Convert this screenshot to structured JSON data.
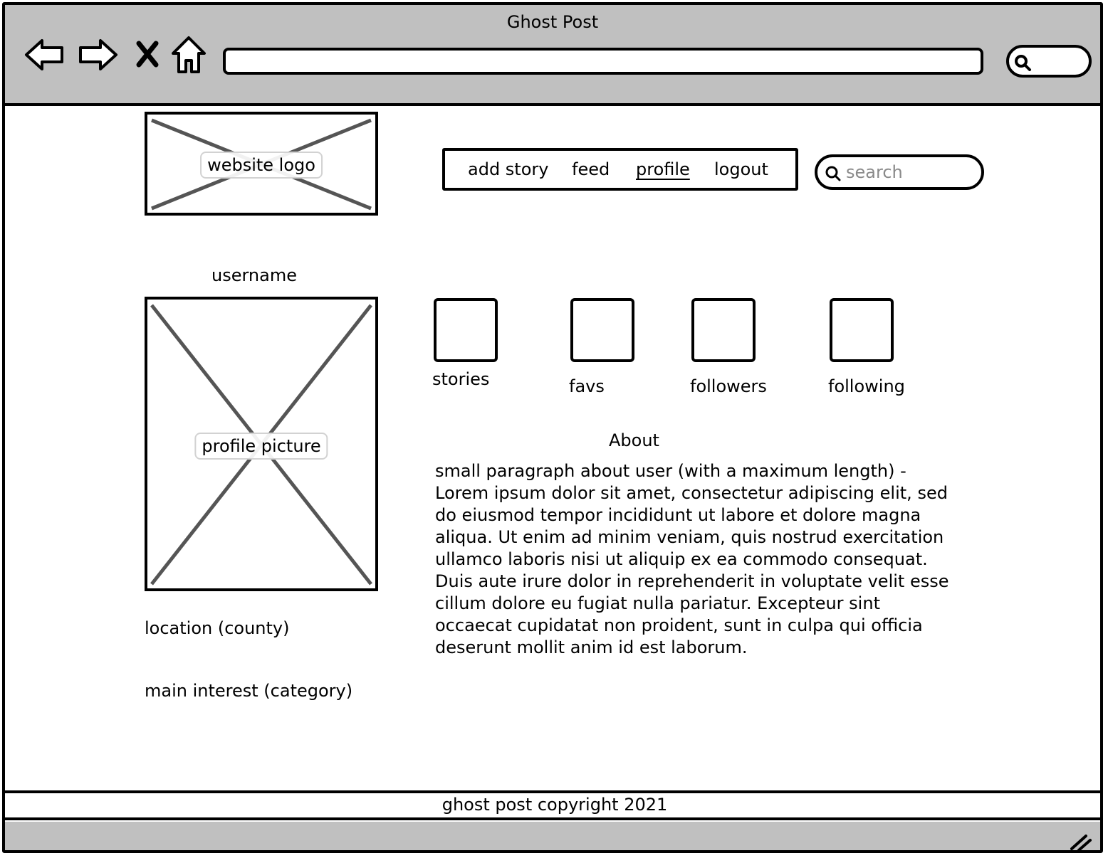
{
  "window": {
    "title": "Ghost Post"
  },
  "header": {
    "logo_label": "website logo",
    "nav": [
      {
        "label": "add story",
        "active": false
      },
      {
        "label": "feed",
        "active": false
      },
      {
        "label": "profile",
        "active": true
      },
      {
        "label": "logout",
        "active": false
      }
    ],
    "search_placeholder": "search"
  },
  "profile": {
    "username": "username",
    "picture_label": "profile picture",
    "location": "location (county)",
    "main_interest": "main interest (category)",
    "stats": [
      {
        "label": "stories"
      },
      {
        "label": "favs"
      },
      {
        "label": "followers"
      },
      {
        "label": "following"
      }
    ],
    "about_title": "About",
    "about_text": "small paragraph about user (with a maximum length) -Lorem ipsum dolor sit amet, consectetur adipiscing elit, sed do eiusmod tempor incididunt ut labore et dolore magna aliqua. Ut enim ad minim veniam, quis nostrud exercitation ullamco laboris nisi ut aliquip ex ea commodo consequat. Duis aute irure dolor in reprehenderit in voluptate velit esse cillum dolore eu fugiat nulla pariatur. Excepteur sint occaecat cupidatat non proident, sunt in culpa qui officia deserunt mollit anim id est laborum."
  },
  "footer": {
    "text": "ghost post copyright 2021"
  },
  "colors": {
    "chrome_gray": "#c0c0c0",
    "placeholder_cross": "#555555",
    "search_placeholder_gray": "#8a8a8a"
  },
  "icons": [
    "back-arrow-icon",
    "forward-arrow-icon",
    "close-icon",
    "home-icon",
    "search-icon",
    "resize-grip-icon"
  ]
}
